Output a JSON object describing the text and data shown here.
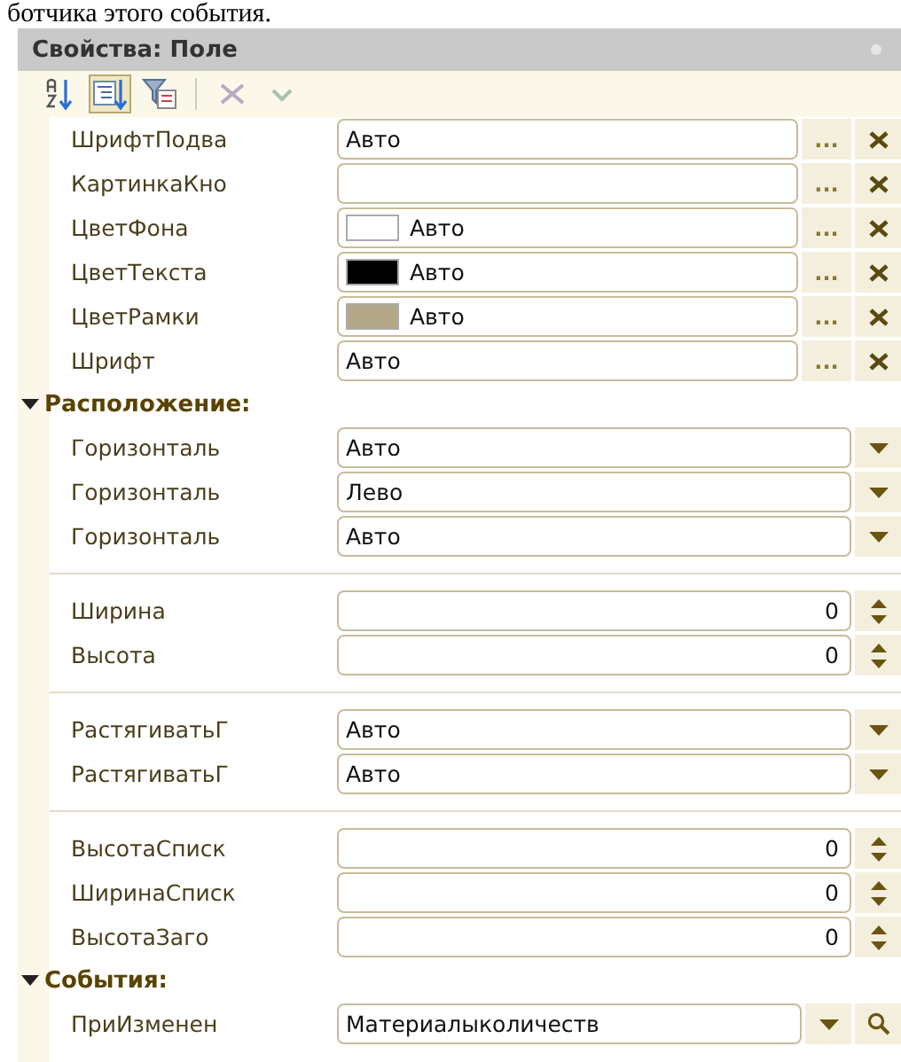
{
  "caption": "ботчика этого события.",
  "panel": {
    "title": "Свойства: Поле",
    "toolbar": [
      {
        "kind": "sort",
        "selected": false,
        "disabled": false
      },
      {
        "kind": "categories",
        "selected": true,
        "disabled": false
      },
      {
        "kind": "filter",
        "selected": false,
        "disabled": false
      },
      {
        "kind": "delete",
        "selected": false,
        "disabled": true
      },
      {
        "kind": "apply",
        "selected": false,
        "disabled": true
      }
    ],
    "top_rows": [
      {
        "kind": "button",
        "label": "ШрифтПодва",
        "value": "Авто",
        "button": "..."
      },
      {
        "kind": "button",
        "label": "КартинкаКно",
        "value": "",
        "button": "..."
      },
      {
        "kind": "color",
        "label": "ЦветФона",
        "value": "Авто",
        "color": "#ffffff",
        "button": "..."
      },
      {
        "kind": "color",
        "label": "ЦветТекста",
        "value": "Авто",
        "color": "#000000",
        "button": "..."
      },
      {
        "kind": "color",
        "label": "ЦветРамки",
        "value": "Авто",
        "color": "#b2a888",
        "button": "..."
      },
      {
        "kind": "button",
        "label": "Шрифт",
        "value": "Авто",
        "button": "..."
      }
    ],
    "sections": [
      {
        "title": "Расположение:",
        "expanded": true,
        "groups": [
          [
            {
              "kind": "dropdown",
              "label": "Горизонталь",
              "value": "Авто"
            },
            {
              "kind": "dropdown",
              "label": "Горизонталь",
              "value": "Лево"
            },
            {
              "kind": "dropdown",
              "label": "Горизонталь",
              "value": "Авто"
            }
          ],
          [
            {
              "kind": "spin",
              "label": "Ширина",
              "value": "0"
            },
            {
              "kind": "spin",
              "label": "Высота",
              "value": "0"
            }
          ],
          [
            {
              "kind": "dropdown",
              "label": "РастягиватьГ",
              "value": "Авто"
            },
            {
              "kind": "dropdown",
              "label": "РастягиватьГ",
              "value": "Авто"
            }
          ],
          [
            {
              "kind": "spin",
              "label": "ВысотаСписк",
              "value": "0"
            },
            {
              "kind": "spin",
              "label": "ШиринаСписк",
              "value": "0"
            },
            {
              "kind": "spin",
              "label": "ВысотаЗаго",
              "value": "0"
            }
          ]
        ]
      },
      {
        "title": "События:",
        "expanded": true,
        "groups": [
          [
            {
              "kind": "choice",
              "label": "ПриИзменен",
              "value": "Материалыколичеств"
            }
          ]
        ]
      }
    ]
  }
}
